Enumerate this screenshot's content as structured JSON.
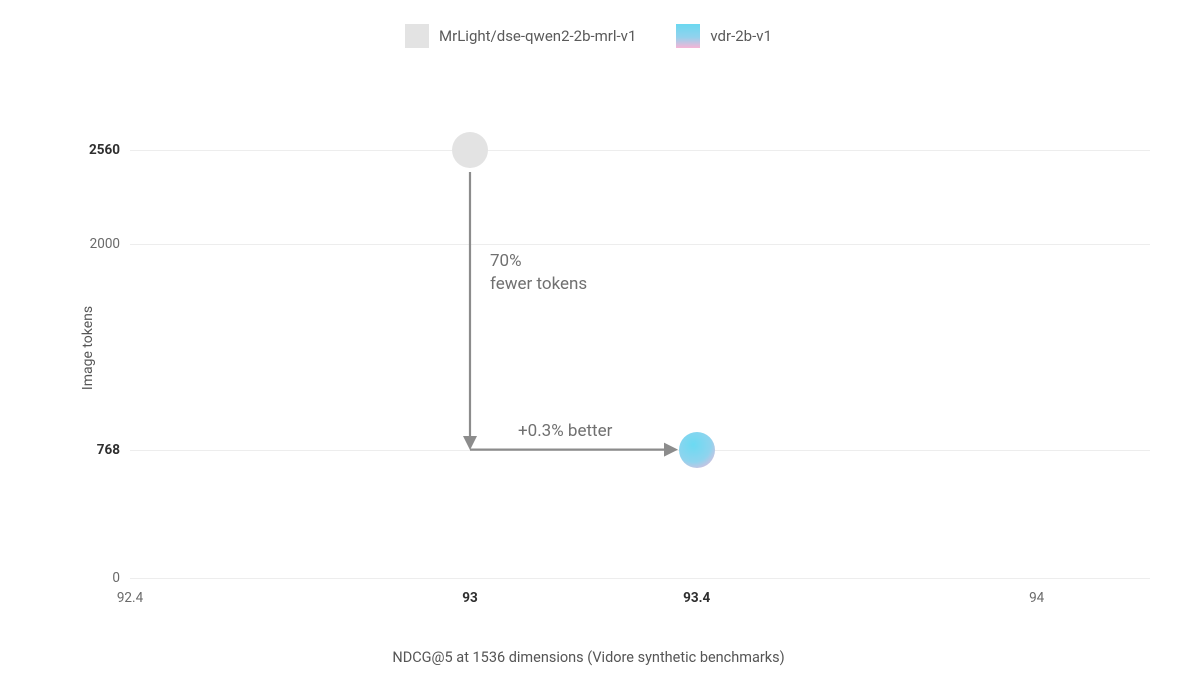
{
  "legend": {
    "series1": "MrLight/dse-qwen2-2b-mrl-v1",
    "series2": "vdr-2b-v1"
  },
  "axes": {
    "y_title": "Image tokens",
    "x_title": "NDCG@5 at 1536 dimensions (Vidore synthetic benchmarks)",
    "y_ticks": {
      "t0": "0",
      "t768": "768",
      "t2000": "2000",
      "t2560": "2560"
    },
    "x_ticks": {
      "x924": "92.4",
      "x93": "93",
      "x934": "93.4",
      "x94": "94"
    }
  },
  "annotations": {
    "fewer_tokens_l1": "70%",
    "fewer_tokens_l2": "fewer tokens",
    "better": "+0.3% better"
  },
  "chart_data": {
    "type": "scatter",
    "xlabel": "NDCG@5 at 1536 dimensions (Vidore synthetic benchmarks)",
    "ylabel": "Image tokens",
    "xlim": [
      92.4,
      94.2
    ],
    "ylim": [
      0,
      2800
    ],
    "x_ticks": [
      92.4,
      93,
      93.4,
      94
    ],
    "y_ticks": [
      0,
      768,
      2000,
      2560
    ],
    "series": [
      {
        "name": "MrLight/dse-qwen2-2b-mrl-v1",
        "points": [
          {
            "x": 93.0,
            "y": 2560
          }
        ],
        "color": "#e3e3e3"
      },
      {
        "name": "vdr-2b-v1",
        "points": [
          {
            "x": 93.4,
            "y": 768
          }
        ],
        "color_gradient": [
          "#6bd8f0",
          "#f6b4d6"
        ]
      }
    ],
    "annotations": [
      {
        "text": "70% fewer tokens",
        "from": {
          "x": 93.0,
          "y": 2560
        },
        "to": {
          "x": 93.0,
          "y": 768
        },
        "arrow": "down"
      },
      {
        "text": "+0.3% better",
        "from": {
          "x": 93.0,
          "y": 768
        },
        "to": {
          "x": 93.4,
          "y": 768
        },
        "arrow": "right"
      }
    ]
  }
}
